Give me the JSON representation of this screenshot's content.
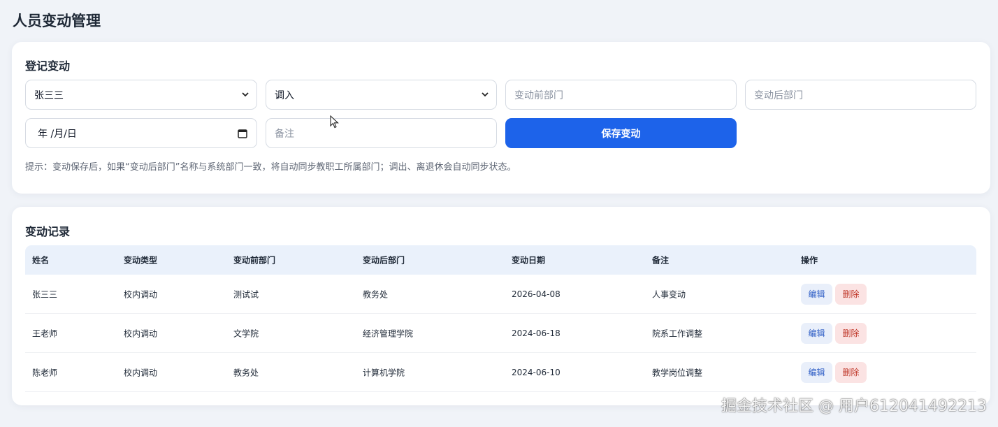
{
  "page": {
    "title": "人员变动管理"
  },
  "register": {
    "title": "登记变动",
    "person_select": "张三三",
    "type_select": "调入",
    "before_dept_placeholder": "变动前部门",
    "after_dept_placeholder": "变动后部门",
    "date_placeholder": "年 /月/日",
    "note_placeholder": "备注",
    "save_label": "保存变动",
    "hint": "提示：变动保存后，如果“变动后部门”名称与系统部门一致，将自动同步教职工所属部门；调出、离退休会自动同步状态。"
  },
  "records": {
    "title": "变动记录",
    "headers": [
      "姓名",
      "变动类型",
      "变动前部门",
      "变动后部门",
      "变动日期",
      "备注",
      "操作"
    ],
    "rows": [
      {
        "name": "张三三",
        "type": "校内调动",
        "before": "测试试",
        "after": "教务处",
        "date": "2026-04-08",
        "note": "人事变动"
      },
      {
        "name": "王老师",
        "type": "校内调动",
        "before": "文学院",
        "after": "经济管理学院",
        "date": "2024-06-18",
        "note": "院系工作调整"
      },
      {
        "name": "陈老师",
        "type": "校内调动",
        "before": "教务处",
        "after": "计算机学院",
        "date": "2024-06-10",
        "note": "教学岗位调整"
      }
    ],
    "edit_label": "编辑",
    "delete_label": "删除"
  },
  "watermark": "掘金技术社区 @ 用户612041492213",
  "icons": {
    "select_arrow": "chevron-down-icon",
    "date_picker": "calendar-icon"
  },
  "colors": {
    "primary": "#1d63ea",
    "edit_bg": "#e9effa",
    "delete_bg": "#fbe3e3",
    "table_header_bg": "#eaf1fb"
  }
}
